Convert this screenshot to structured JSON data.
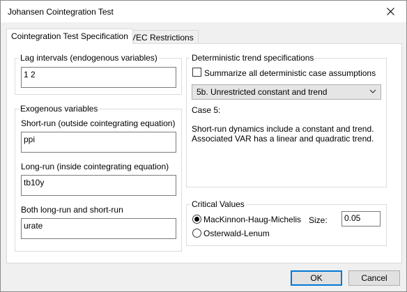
{
  "window": {
    "title": "Johansen Cointegration Test"
  },
  "tabs": [
    {
      "label": "Cointegration Test Specification",
      "active": true
    },
    {
      "label": "VEC Restrictions",
      "active": false
    }
  ],
  "lag_intervals": {
    "legend": "Lag intervals (endogenous variables)",
    "value": "1 2"
  },
  "exogenous": {
    "legend": "Exogenous variables",
    "short_run_label": "Short-run (outside cointegrating equation)",
    "short_run_value": "ppi",
    "long_run_label": "Long-run (inside cointegrating equation)",
    "long_run_value": "tb10y",
    "both_label": "Both long-run and short-run",
    "both_value": "urate"
  },
  "deterministic": {
    "legend": "Deterministic trend specifications",
    "summarize_label": "Summarize all deterministic case assumptions",
    "summarize_checked": false,
    "selected_case": "5b. Unrestricted constant and trend",
    "case_title": "Case 5:",
    "case_line1": "Short-run dynamics include a constant and trend.",
    "case_line2": "Associated VAR has a linear and quadratic trend."
  },
  "critical_values": {
    "legend": "Critical Values",
    "option1": "MacKinnon-Haug-Michelis",
    "option2": "Osterwald-Lenum",
    "selected": "MacKinnon-Haug-Michelis",
    "size_label": "Size:",
    "size_value": "0.05"
  },
  "buttons": {
    "ok": "OK",
    "cancel": "Cancel"
  },
  "icons": {
    "close": "close-icon",
    "dropdown": "chevron-down-icon"
  },
  "colors": {
    "default_button_border": "#0078d7",
    "panel_bg": "#ffffff",
    "window_bg": "#f0f0f0"
  }
}
